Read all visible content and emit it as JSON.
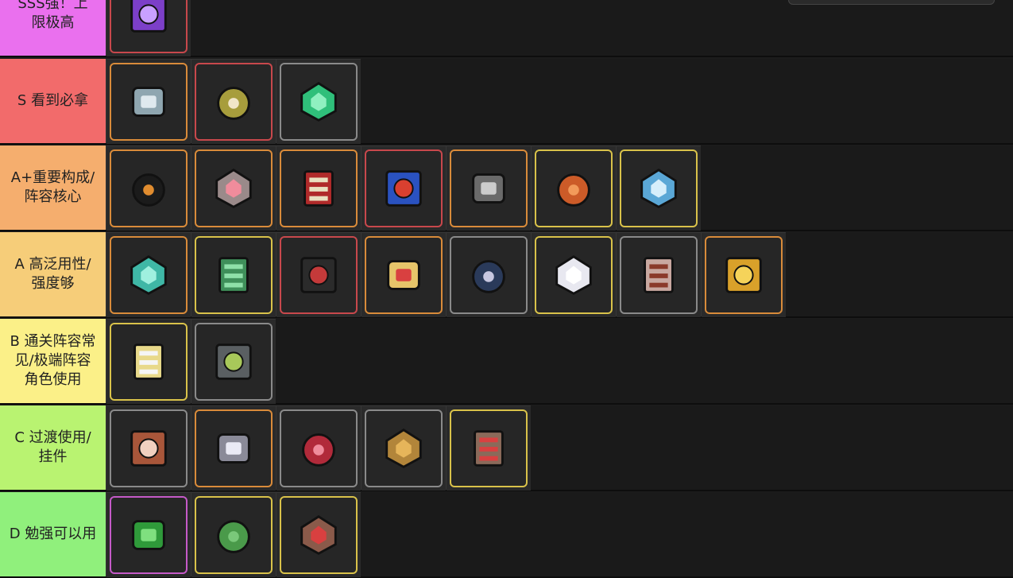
{
  "tiers": [
    {
      "label": "SSS强！上\n限极高",
      "color": "#ea70ee",
      "icons": [
        {
          "name": "purple-gear-module-icon",
          "frame": "#c8484c",
          "fill": "#7c3fc8",
          "accent": "#c9a0ff"
        }
      ]
    },
    {
      "label": "S 看到必拿",
      "color": "#f26b6b",
      "icons": [
        {
          "name": "grey-hex-plate-icon",
          "frame": "#d98b3a",
          "fill": "#8fa6b0",
          "accent": "#dfe9ee"
        },
        {
          "name": "dome-core-icon",
          "frame": "#c8484c",
          "fill": "#a79d3c",
          "accent": "#f1e6c8"
        },
        {
          "name": "green-crystal-block-icon",
          "frame": "#8a8a8a",
          "fill": "#2fbf7a",
          "accent": "#8ff0c0"
        }
      ]
    },
    {
      "label": "A+重要构成/\n阵容核心",
      "color": "#f5ae6e",
      "icons": [
        {
          "name": "black-reactor-core-icon",
          "frame": "#d98b3a",
          "fill": "#1b1b1b",
          "accent": "#e08c2f"
        },
        {
          "name": "pink-frame-chip-icon",
          "frame": "#d98b3a",
          "fill": "#9a8a8a",
          "accent": "#f08c9c"
        },
        {
          "name": "red-battery-module-icon",
          "frame": "#d98b3a",
          "fill": "#b02a2a",
          "accent": "#e9e0c0"
        },
        {
          "name": "blue-red-grid-icon",
          "frame": "#c8484c",
          "fill": "#2a52c0",
          "accent": "#d94030"
        },
        {
          "name": "triple-wheel-icon",
          "frame": "#d98b3a",
          "fill": "#6a6a6a",
          "accent": "#cccccc"
        },
        {
          "name": "orange-bag-icon",
          "frame": "#d9c24a",
          "fill": "#cc5b28",
          "accent": "#f29a5a"
        },
        {
          "name": "blue-rocket-icon",
          "frame": "#d9c24a",
          "fill": "#5aa7d6",
          "accent": "#d6eefb"
        }
      ]
    },
    {
      "label": "A 高泛用性/\n强度够",
      "color": "#f6cd79",
      "icons": [
        {
          "name": "teal-crystal-tile-icon",
          "frame": "#d98b3a",
          "fill": "#3fb7a6",
          "accent": "#9ff0df"
        },
        {
          "name": "green-tentacle-crate-icon",
          "frame": "#d9c24a",
          "fill": "#3f8f5a",
          "accent": "#8fe0a9"
        },
        {
          "name": "red-cannon-turret-icon",
          "frame": "#c8484c",
          "fill": "#2b2b2b",
          "accent": "#c43a3a"
        },
        {
          "name": "yellow-slot-machine-icon",
          "frame": "#d98b3a",
          "fill": "#e6c46a",
          "accent": "#d94040"
        },
        {
          "name": "fan-module-icon",
          "frame": "#8a8a8a",
          "fill": "#2a3a5a",
          "accent": "#c7c7e0"
        },
        {
          "name": "white-orb-icon",
          "frame": "#d9c24a",
          "fill": "#e8e8f0",
          "accent": "#ffffff"
        },
        {
          "name": "spiked-frame-icon",
          "frame": "#8a8a8a",
          "fill": "#c9a8a0",
          "accent": "#8a3a2a"
        },
        {
          "name": "golden-honey-block-icon",
          "frame": "#d98b3a",
          "fill": "#d9a12a",
          "accent": "#f5d35a"
        }
      ]
    },
    {
      "label": "B 通关阵容常\n见/极端阵容\n角色使用",
      "color": "#fbf088",
      "icons": [
        {
          "name": "winged-emblem-icon",
          "frame": "#d9c24a",
          "fill": "#e8d98a",
          "accent": "#f5f5f5"
        },
        {
          "name": "grey-console-icon",
          "frame": "#8a8a8a",
          "fill": "#5a5f62",
          "accent": "#a8c85a"
        }
      ]
    },
    {
      "label": "C 过渡使用/\n挂件",
      "color": "#b9f371",
      "icons": [
        {
          "name": "copper-ore-tile-icon",
          "frame": "#8a8a8a",
          "fill": "#a8563a",
          "accent": "#f1d0c0"
        },
        {
          "name": "silver-ore-tile-icon",
          "frame": "#d98b3a",
          "fill": "#8a8a98",
          "accent": "#eaeaf5"
        },
        {
          "name": "red-cross-totem-icon",
          "frame": "#8a8a8a",
          "fill": "#b12a3a",
          "accent": "#f08c9c"
        },
        {
          "name": "honeycomb-cluster-icon",
          "frame": "#8a8a8a",
          "fill": "#b2853a",
          "accent": "#e6b55a"
        },
        {
          "name": "small-robot-icon",
          "frame": "#d9c24a",
          "fill": "#8a6a5a",
          "accent": "#d94040"
        }
      ]
    },
    {
      "label": "D 勉强可以用",
      "color": "#90f07c",
      "icons": [
        {
          "name": "green-vine-icon",
          "frame": "#c55ac8",
          "fill": "#2f9a3a",
          "accent": "#7fe07f"
        },
        {
          "name": "green-blob-icon",
          "frame": "#d9c24a",
          "fill": "#4a9a4a",
          "accent": "#7ac87a"
        },
        {
          "name": "red-eye-robot-icon",
          "frame": "#d9c24a",
          "fill": "#8a5a4a",
          "accent": "#d94040"
        }
      ]
    }
  ]
}
